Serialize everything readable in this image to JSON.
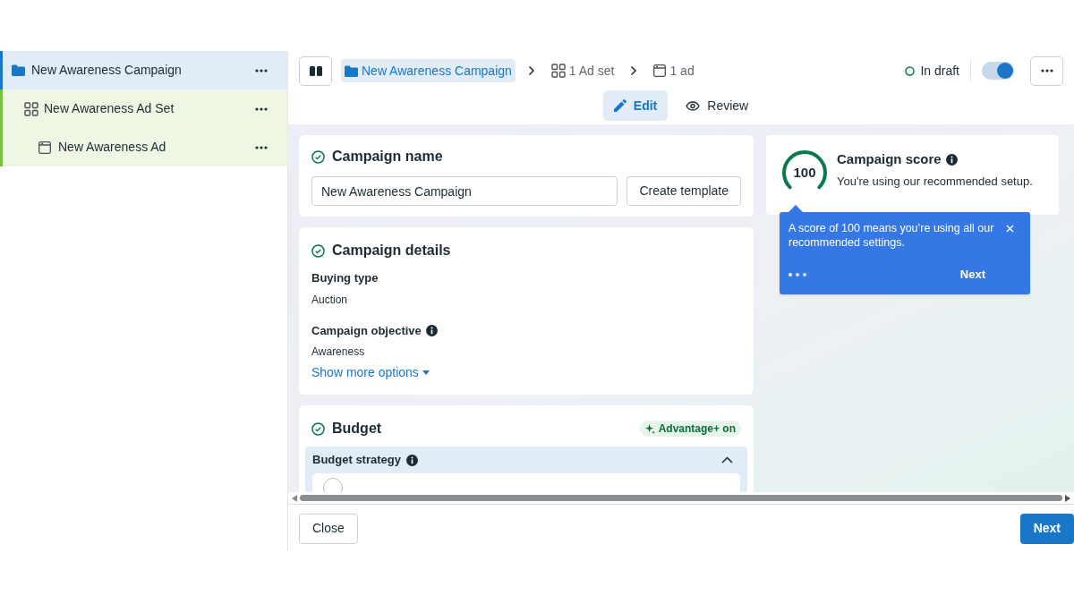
{
  "tree": [
    {
      "label": "New Awareness Campaign",
      "kind": "campaign",
      "selected": true,
      "children": [
        {
          "label": "New Awareness Ad Set",
          "kind": "adset",
          "selected": false,
          "children": [
            {
              "label": "New Awareness Ad",
              "kind": "ad",
              "selected": false
            }
          ]
        }
      ]
    }
  ],
  "breadcrumb": [
    {
      "label": "New Awareness Campaign",
      "kind": "campaign",
      "selected": true
    },
    {
      "label": "1 Ad set",
      "kind": "adset",
      "selected": false
    },
    {
      "label": "1 ad",
      "kind": "ad",
      "selected": false
    }
  ],
  "status": {
    "label": "In draft",
    "on": true
  },
  "tabs": [
    {
      "label": "Edit",
      "kind": "edit",
      "selected": true
    },
    {
      "label": "Review",
      "kind": "review",
      "selected": false
    }
  ],
  "campaign_name": {
    "title": "Campaign name",
    "value": "New Awareness Campaign",
    "button": "Create template"
  },
  "campaign_details": {
    "title": "Campaign details",
    "fields": [
      {
        "label": "Buying type",
        "value": "Auction",
        "info": false
      },
      {
        "label": "Campaign objective",
        "value": "Awareness",
        "info": true
      }
    ],
    "link": "Show more options"
  },
  "budget": {
    "title": "Budget",
    "badge": "Advantage+ on",
    "section": {
      "title": "Budget strategy",
      "expanded": true,
      "options": [
        {
          "selected": false
        }
      ]
    }
  },
  "score": {
    "value": "100",
    "title": "Campaign score",
    "subtitle": "You're using our recommended setup."
  },
  "tooltip": {
    "text": "A score of 100 means you’re using all our recommended settings.",
    "next": "Next"
  },
  "footer": {
    "close": "Close",
    "next": "Next"
  }
}
